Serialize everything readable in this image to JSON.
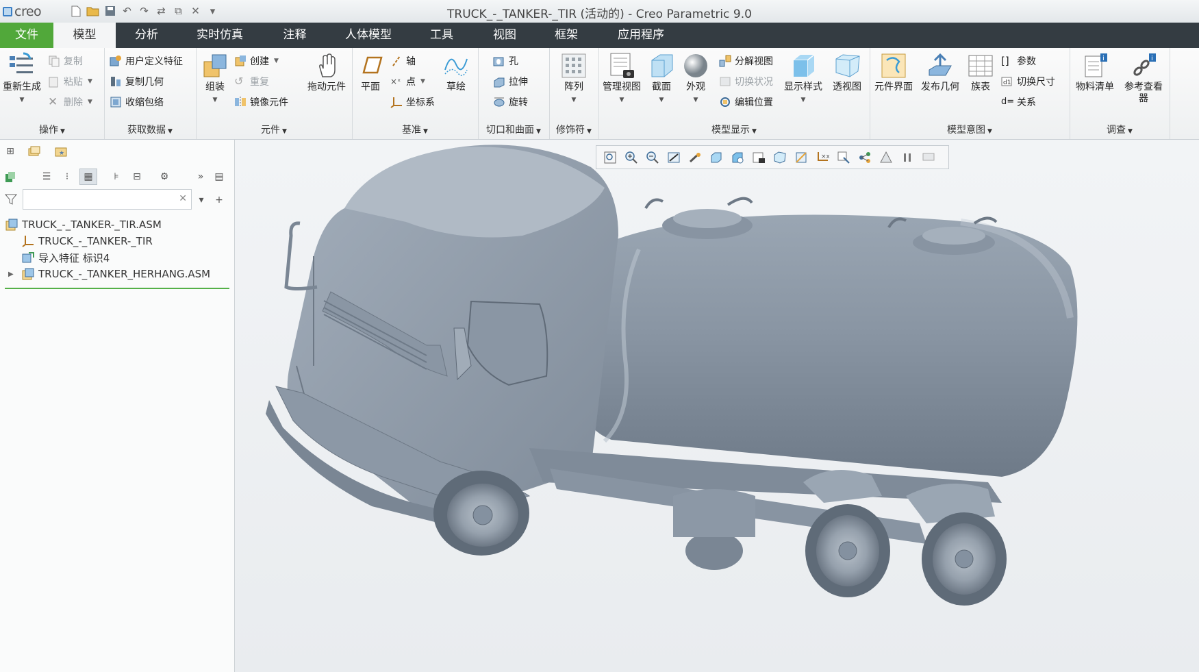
{
  "app": {
    "logo_text": "creo",
    "window_title": "TRUCK_-_TANKER-_TIR (活动的) - Creo Parametric 9.0"
  },
  "quick_access": [
    "new-icon",
    "open-icon",
    "save-icon",
    "undo-icon",
    "redo-icon",
    "regenerate-icon",
    "windows-icon",
    "close-icon",
    "customize-icon"
  ],
  "menu": {
    "tabs": [
      "文件",
      "模型",
      "分析",
      "实时仿真",
      "注释",
      "人体模型",
      "工具",
      "视图",
      "框架",
      "应用程序"
    ],
    "active": "模型"
  },
  "ribbon": {
    "operations": {
      "label": "操作",
      "regenerate": "重新生成",
      "copy": "复制",
      "paste": "粘贴",
      "delete": "删除"
    },
    "get_data": {
      "label": "获取数据",
      "udf": "用户定义特征",
      "copy_geom": "复制几何",
      "shrinkwrap": "收缩包络"
    },
    "component": {
      "label": "元件",
      "assemble": "组装",
      "create": "创建",
      "repeat": "重复",
      "mirror": "镜像元件",
      "drag": "拖动元件"
    },
    "datum": {
      "label": "基准",
      "plane": "平面",
      "axis": "轴",
      "point": "点",
      "csys": "坐标系",
      "sketch": "草绘"
    },
    "cut_surface": {
      "label": "切口和曲面",
      "hole": "孔",
      "extrude": "拉伸",
      "revolve": "旋转"
    },
    "modifiers": {
      "label": "修饰符",
      "pattern": "阵列"
    },
    "model_display": {
      "label": "模型显示",
      "manage_views": "管理视图",
      "section": "截面",
      "appearance": "外观",
      "exploded": "分解视图",
      "toggle_status": "切换状况",
      "edit_position": "编辑位置",
      "display_style": "显示样式",
      "perspective": "透视图"
    },
    "model_intent": {
      "label": "模型意图",
      "comp_interface": "元件界面",
      "publish_geom": "发布几何",
      "family_table": "族表",
      "parameters": "参数",
      "switch_dims": "切换尺寸",
      "relations": "关系"
    },
    "investigate": {
      "label": "调查",
      "bom": "物料清单",
      "ref_viewer_1": "参考查看",
      "ref_viewer_2": "器"
    }
  },
  "model_tree": {
    "filter_placeholder": "",
    "items": [
      {
        "label": "TRUCK_-_TANKER-_TIR.ASM",
        "icon": "assembly-icon"
      },
      {
        "label": "TRUCK_-_TANKER-_TIR",
        "icon": "csys-icon"
      },
      {
        "label": "导入特征 标识4",
        "icon": "import-feature-icon"
      },
      {
        "label": "TRUCK_-_TANKER_HERHANG.ASM",
        "icon": "assembly-icon",
        "expandable": true
      }
    ]
  },
  "view_toolbar": [
    "refit-icon",
    "zoom-in-icon",
    "zoom-out-icon",
    "repaint-icon",
    "spin-center-icon",
    "saved-views-icon",
    "display-style-icon",
    "named-views-icon",
    "perspective-icon",
    "section-icon",
    "datum-display-icon",
    "annotation-display-icon",
    "explode-icon",
    "appearance-icon",
    "pause-icon",
    "screen-icon"
  ],
  "colors": {
    "accent_green": "#51a83a",
    "menubar": "#343c42",
    "model": "#8a97a5"
  }
}
